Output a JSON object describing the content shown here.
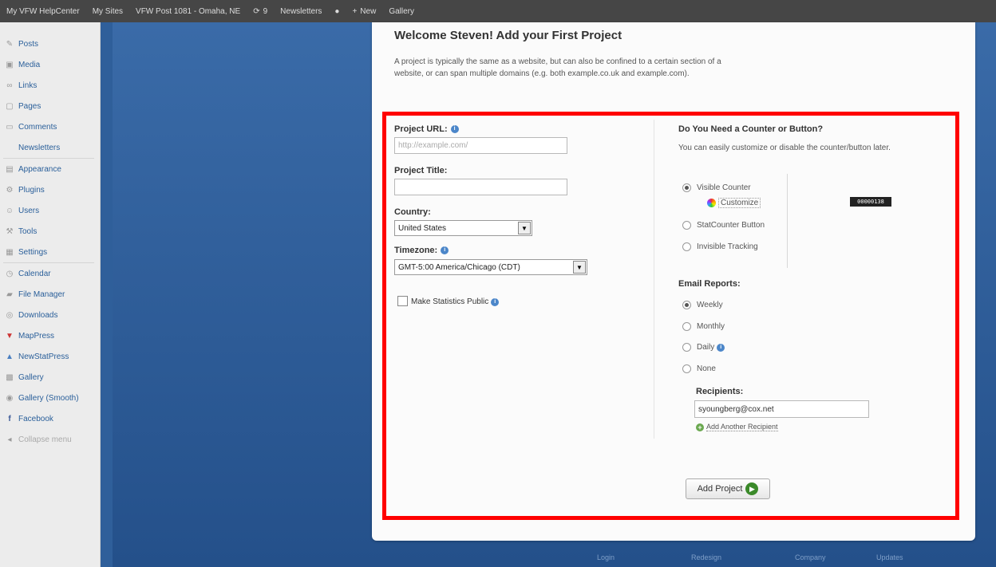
{
  "adminbar": {
    "items": [
      "My VFW HelpCenter",
      "My Sites",
      "VFW Post 1081 - Omaha, NE",
      "9",
      "Newsletters",
      "",
      "New",
      "Gallery"
    ]
  },
  "sidebar": {
    "items": [
      {
        "label": "Posts",
        "icon": "pin-icon"
      },
      {
        "label": "Media",
        "icon": "media-icon"
      },
      {
        "label": "Links",
        "icon": "link-icon"
      },
      {
        "label": "Pages",
        "icon": "pages-icon"
      },
      {
        "label": "Comments",
        "icon": "comments-icon"
      },
      {
        "label": "Newsletters",
        "icon": ""
      },
      {
        "label": "Appearance",
        "icon": "appearance-icon"
      },
      {
        "label": "Plugins",
        "icon": "plugins-icon"
      },
      {
        "label": "Users",
        "icon": "users-icon"
      },
      {
        "label": "Tools",
        "icon": "tools-icon"
      },
      {
        "label": "Settings",
        "icon": "settings-icon"
      },
      {
        "label": "Calendar",
        "icon": "calendar-icon"
      },
      {
        "label": "File Manager",
        "icon": "file-manager-icon"
      },
      {
        "label": "Downloads",
        "icon": "downloads-icon"
      },
      {
        "label": "MapPress",
        "icon": "map-pin-icon"
      },
      {
        "label": "NewStatPress",
        "icon": "stats-icon"
      },
      {
        "label": "Gallery",
        "icon": "gallery-icon"
      },
      {
        "label": "Gallery (Smooth)",
        "icon": "gallery-smooth-icon"
      },
      {
        "label": "Facebook",
        "icon": "facebook-icon"
      },
      {
        "label": "Collapse menu",
        "icon": "collapse-icon"
      }
    ]
  },
  "main": {
    "title": "Welcome Steven!  Add your First Project",
    "intro": "A project is typically the same as a website, but can also be confined to a certain section of a website, or can span multiple domains (e.g. both example.co.uk and example.com).",
    "project_url": {
      "label": "Project URL:",
      "placeholder": "http://example.com/",
      "value": ""
    },
    "project_title": {
      "label": "Project Title:",
      "value": ""
    },
    "country": {
      "label": "Country:",
      "selected": "United States"
    },
    "timezone": {
      "label": "Timezone:",
      "selected": "GMT-5:00 America/Chicago (CDT)"
    },
    "make_public": {
      "label": "Make Statistics Public",
      "checked": false
    },
    "counter_section": {
      "title": "Do You Need a Counter or Button?",
      "description": "You can easily customize or disable the counter/button later.",
      "options": [
        {
          "label": "Visible Counter",
          "checked": true
        },
        {
          "label": "StatCounter Button",
          "checked": false
        },
        {
          "label": "Invisible Tracking",
          "checked": false
        }
      ],
      "customize_label": "Customize",
      "counter_preview": "00000138"
    },
    "email_reports": {
      "title": "Email Reports:",
      "options": [
        {
          "label": "Weekly",
          "checked": true
        },
        {
          "label": "Monthly",
          "checked": false
        },
        {
          "label": "Daily",
          "checked": false
        },
        {
          "label": "None",
          "checked": false
        }
      ]
    },
    "recipients": {
      "label": "Recipients:",
      "value": "syoungberg@cox.net",
      "add_label": "Add Another Recipient"
    },
    "add_project_label": "Add Project"
  },
  "footer": {
    "links": [
      "Login",
      "Redesign",
      "Company",
      "Updates"
    ]
  },
  "colors": {
    "admin_bar": "#464646",
    "background_blue": "#2f5f9a",
    "highlight_red": "#ff0000",
    "link_blue": "#2a5f9a"
  }
}
